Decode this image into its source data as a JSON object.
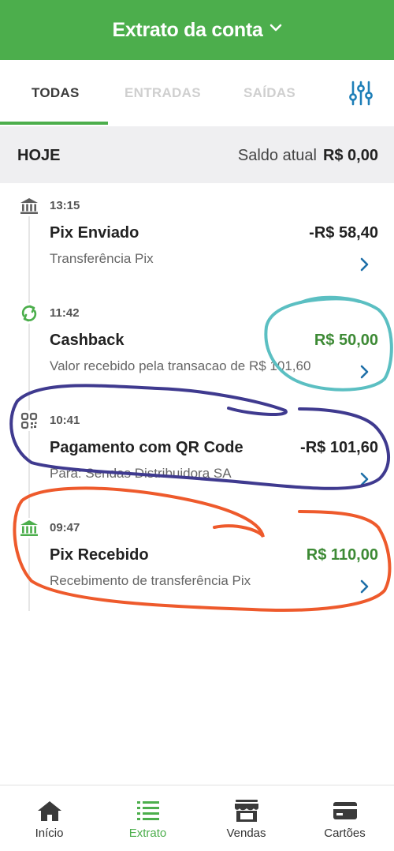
{
  "header": {
    "title": "Extrato da conta"
  },
  "tabs": [
    {
      "label": "TODAS",
      "active": true
    },
    {
      "label": "ENTRADAS",
      "active": false
    },
    {
      "label": "SAÍDAS",
      "active": false
    }
  ],
  "filter": {
    "icon": "sliders-icon"
  },
  "day": {
    "label": "HOJE",
    "balance_label": "Saldo atual",
    "balance_value": "R$ 0,00"
  },
  "transactions": [
    {
      "time": "13:15",
      "title": "Pix Enviado",
      "amount": "-R$ 58,40",
      "description": "Transferência Pix",
      "icon": "bank-icon",
      "direction": "out"
    },
    {
      "time": "11:42",
      "title": "Cashback",
      "amount": "R$ 50,00",
      "description": "Valor recebido pela transacao de R$ 101,60",
      "icon": "refresh-icon",
      "direction": "in"
    },
    {
      "time": "10:41",
      "title": "Pagamento com QR Code",
      "amount": "-R$ 101,60",
      "description": "Para: Sendas Distribuidora SA",
      "icon": "qr-code-icon",
      "direction": "out"
    },
    {
      "time": "09:47",
      "title": "Pix Recebido",
      "amount": "R$ 110,00",
      "description": "Recebimento de transferência Pix",
      "icon": "bank-icon",
      "direction": "in"
    }
  ],
  "nav": [
    {
      "label": "Início",
      "icon": "home-icon",
      "active": false
    },
    {
      "label": "Extrato",
      "icon": "list-icon",
      "active": true
    },
    {
      "label": "Vendas",
      "icon": "store-icon",
      "active": false
    },
    {
      "label": "Cartões",
      "icon": "card-icon",
      "active": false
    }
  ],
  "colors": {
    "brand_green": "#4cae4c",
    "positive_amount": "#3d8a35",
    "link_blue": "#1e7fb8",
    "annotation_teal": "#5bbfc2",
    "annotation_navy": "#3f3a8f",
    "annotation_orange": "#ee5a2c"
  }
}
